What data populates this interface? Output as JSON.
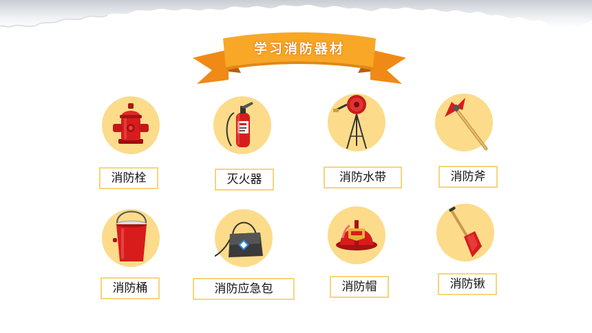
{
  "title": "学习消防器材",
  "items": [
    {
      "label": "消防栓",
      "icon": "fire-hydrant-icon"
    },
    {
      "label": "灭火器",
      "icon": "fire-extinguisher-icon"
    },
    {
      "label": "消防水带",
      "icon": "fire-hose-reel-icon"
    },
    {
      "label": "消防斧",
      "icon": "fire-axe-icon"
    },
    {
      "label": "消防桶",
      "icon": "fire-bucket-icon"
    },
    {
      "label": "消防应急包",
      "icon": "emergency-bag-icon"
    },
    {
      "label": "消防帽",
      "icon": "fire-helmet-icon"
    },
    {
      "label": "消防锹",
      "icon": "fire-shovel-icon"
    }
  ],
  "colors": {
    "circle": "#fcdc8a",
    "ribbon": "#f8a726",
    "label_border": "#f6d57a",
    "equipment_red": "#d81c1c"
  }
}
